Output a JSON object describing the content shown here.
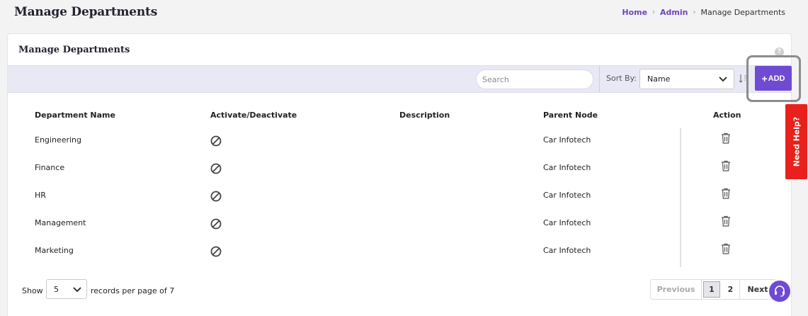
{
  "header": {
    "title": "Manage Departments",
    "breadcrumb": {
      "home": "Home",
      "admin": "Admin",
      "current": "Manage Departments"
    }
  },
  "card": {
    "title": "Manage Departments",
    "help_icon": "?"
  },
  "toolbar": {
    "search_placeholder": "Search",
    "sort_label": "Sort By:",
    "sort_value": "Name",
    "add_plus": "+",
    "add_label": "ADD"
  },
  "table": {
    "columns": [
      "Department Name",
      "Activate/Deactivate",
      "Description",
      "Parent Node",
      "Action"
    ],
    "rows": [
      {
        "name": "Engineering",
        "description": "",
        "parent": "Car Infotech"
      },
      {
        "name": "Finance",
        "description": "",
        "parent": "Car Infotech"
      },
      {
        "name": "HR",
        "description": "",
        "parent": "Car Infotech"
      },
      {
        "name": "Management",
        "description": "",
        "parent": "Car Infotech"
      },
      {
        "name": "Marketing",
        "description": "",
        "parent": "Car Infotech"
      }
    ]
  },
  "footer": {
    "show_label": "Show",
    "page_size": "5",
    "records_label": "records per page of 7",
    "previous": "Previous",
    "page1": "1",
    "page2": "2",
    "next": "Next"
  },
  "need_help": "Need Help?",
  "colors": {
    "accent": "#6f4ad2",
    "need_help": "#e8211d",
    "toolbar_bg": "#e8e9f5"
  },
  "icons": {
    "status": "ban-icon",
    "action": "trash-icon",
    "support": "headset-icon"
  }
}
